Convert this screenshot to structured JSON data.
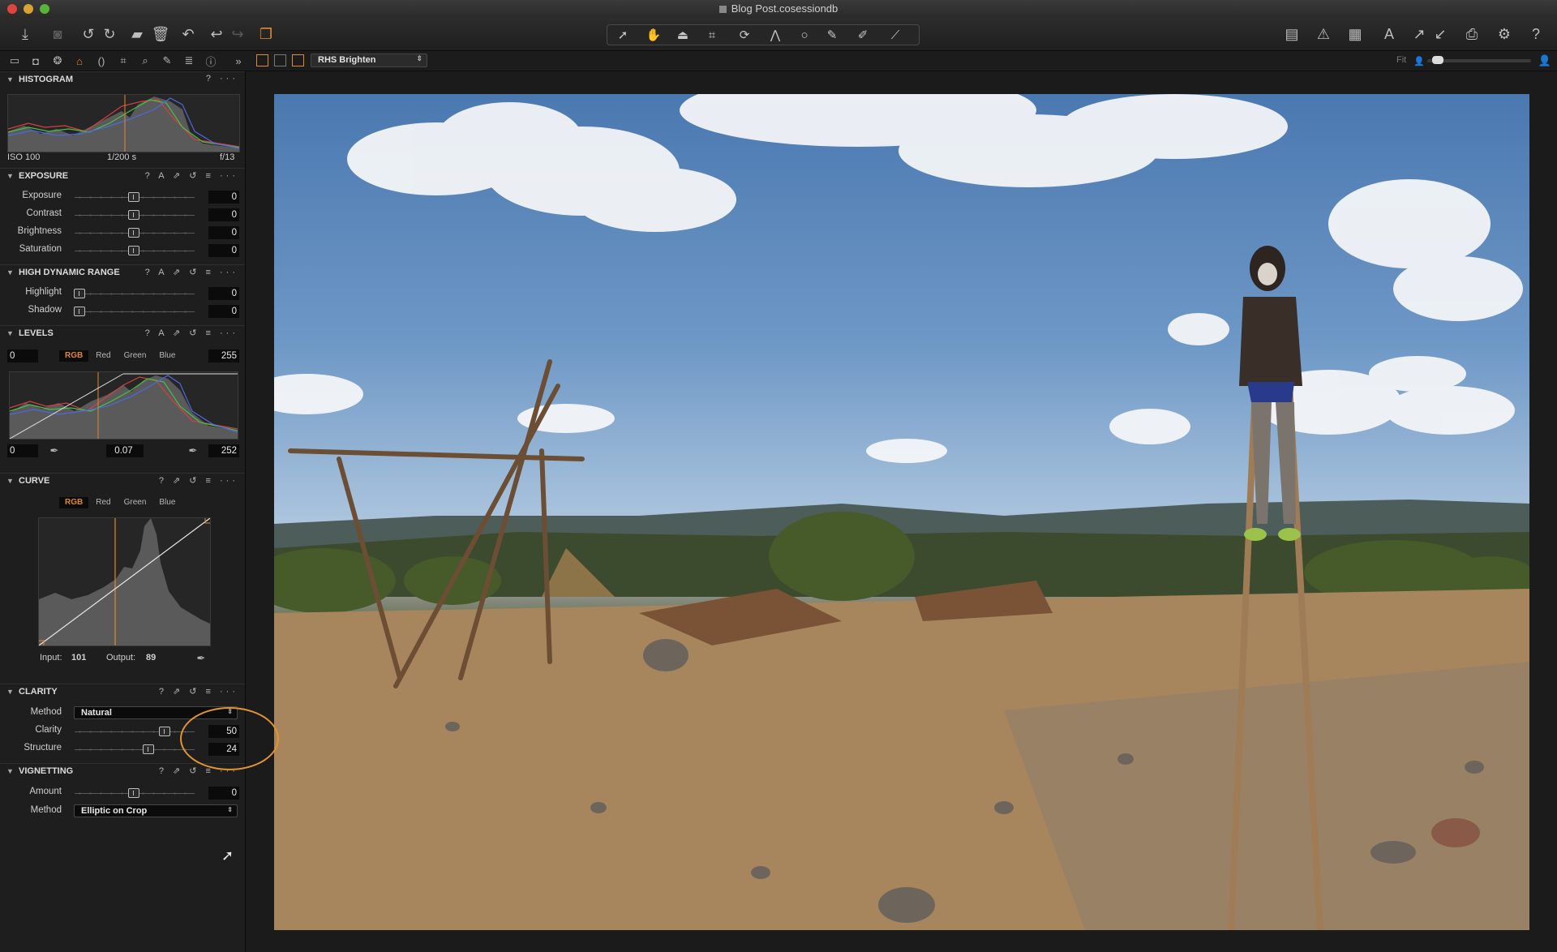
{
  "window": {
    "title": "Blog Post.cosessiondb"
  },
  "toolbar": {
    "left_icons": [
      "import-icon",
      "camera-icon",
      "rotate-left-icon",
      "rotate-right-icon",
      "move-to-icon",
      "trash-icon",
      "undo-history-icon",
      "undo-icon",
      "redo-icon",
      "variants-icon"
    ],
    "cursor_tools": [
      "select-icon",
      "hand-icon",
      "keystone-icon",
      "crop-icon",
      "rotate-icon",
      "keystone-lines-icon",
      "circle-mask-icon",
      "brush-icon",
      "erase-icon",
      "pick-icon"
    ],
    "right_icons": [
      "viewer-layout-icon",
      "warning-icon",
      "grid-icon",
      "annotate-icon",
      "copy-adjust-icon",
      "paste-adjust-icon",
      "print-icon",
      "settings-icon",
      "help-icon"
    ]
  },
  "subbar": {
    "style_preset": "RHS Brighten",
    "fit_label": "Fit",
    "zoom_fraction": 0.05
  },
  "histogram": {
    "title": "HISTOGRAM",
    "iso": "ISO 100",
    "shutter": "1/200 s",
    "aperture": "f/13"
  },
  "exposure": {
    "title": "EXPOSURE",
    "rows": [
      {
        "label": "Exposure",
        "value": "0"
      },
      {
        "label": "Contrast",
        "value": "0"
      },
      {
        "label": "Brightness",
        "value": "0"
      },
      {
        "label": "Saturation",
        "value": "0"
      }
    ]
  },
  "hdr": {
    "title": "HIGH DYNAMIC RANGE",
    "rows": [
      {
        "label": "Highlight",
        "value": "0"
      },
      {
        "label": "Shadow",
        "value": "0"
      }
    ]
  },
  "levels": {
    "title": "LEVELS",
    "channels": [
      "RGB",
      "Red",
      "Green",
      "Blue"
    ],
    "input_low": "0",
    "input_high": "255",
    "output_low": "0",
    "midtone": "0.07",
    "output_high": "252"
  },
  "curve": {
    "title": "CURVE",
    "channels": [
      "RGB",
      "Red",
      "Green",
      "Blue"
    ],
    "input_label": "Input:",
    "input_value": "101",
    "output_label": "Output:",
    "output_value": "89"
  },
  "clarity": {
    "title": "CLARITY",
    "method_label": "Method",
    "method_value": "Natural",
    "clarity_label": "Clarity",
    "clarity_value": "50",
    "structure_label": "Structure",
    "structure_value": "24"
  },
  "vignetting": {
    "title": "VIGNETTING",
    "amount_label": "Amount",
    "amount_value": "0",
    "method_label": "Method",
    "method_value": "Elliptic on Crop"
  },
  "colors": {
    "accent": "#e08a2c",
    "panel_bg": "#1e1e1e",
    "value_bg": "#0b0b0b"
  }
}
